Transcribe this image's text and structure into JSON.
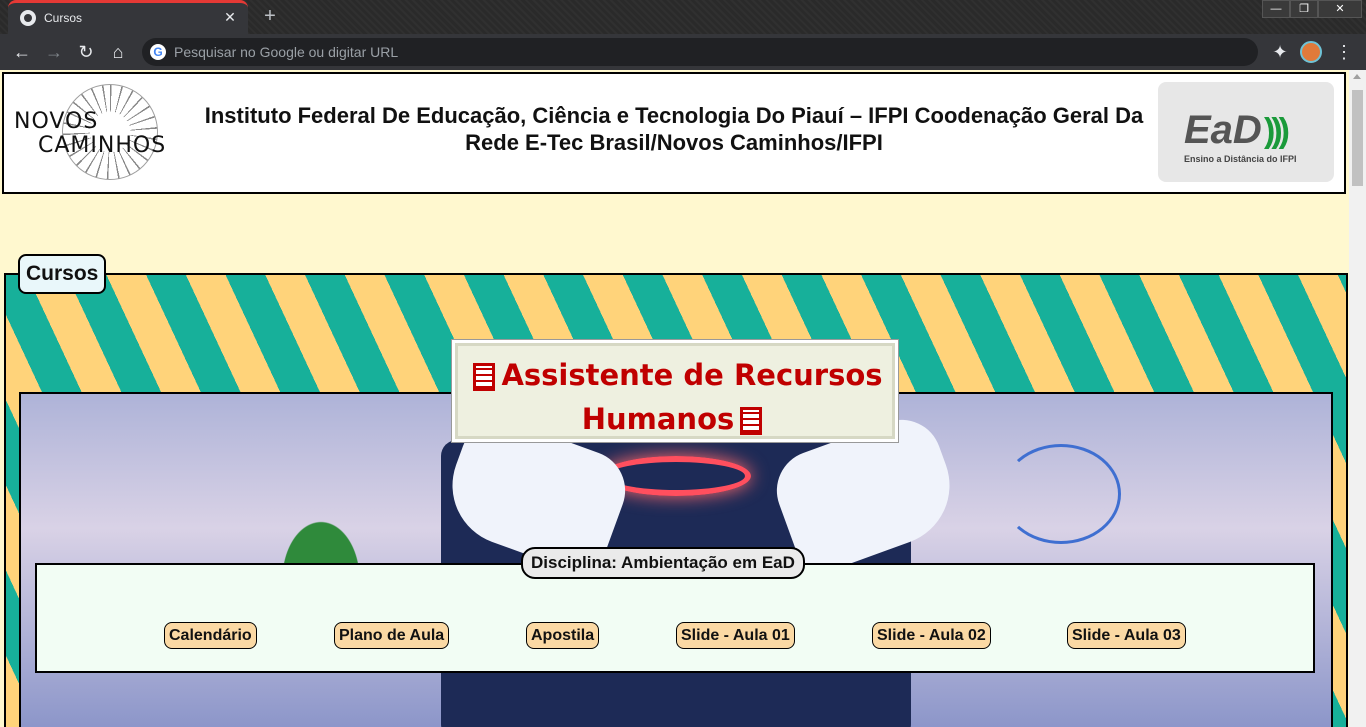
{
  "browser": {
    "tab_title": "Cursos",
    "tab_close": "✕",
    "new_tab": "+",
    "omnibox_placeholder": "Pesquisar no Google ou digitar URL",
    "window_controls": [
      "—",
      "❐",
      "✕"
    ]
  },
  "header": {
    "logo_left_line1": "NOVOS",
    "logo_left_line2": "CAMINHOS",
    "title": "Instituto Federal De Educação, Ciência e Tecnologia Do Piauí – IFPI Coodenação Geral Da Rede E-Tec Brasil/Novos Caminhos/IFPI",
    "logo_right_main": "EaD",
    "logo_right_arcs": ")))",
    "logo_right_sub": "Ensino a Distância do IFPI"
  },
  "cursos": {
    "legend": "Cursos",
    "course_title": "Assistente de Recursos Humanos",
    "discipline": {
      "legend": "Disciplina: Ambientação em EaD",
      "links": [
        "Calendário",
        "Plano de Aula",
        "Apostila",
        "Slide - Aula 01",
        "Slide - Aula 02",
        "Slide - Aula 03"
      ]
    }
  },
  "colors": {
    "accent_red": "#c00000",
    "page_bg": "#fff8cf",
    "stripe_yellow": "#ffd37a",
    "stripe_teal": "#17b09a",
    "link_bg": "#fbd9a4"
  }
}
